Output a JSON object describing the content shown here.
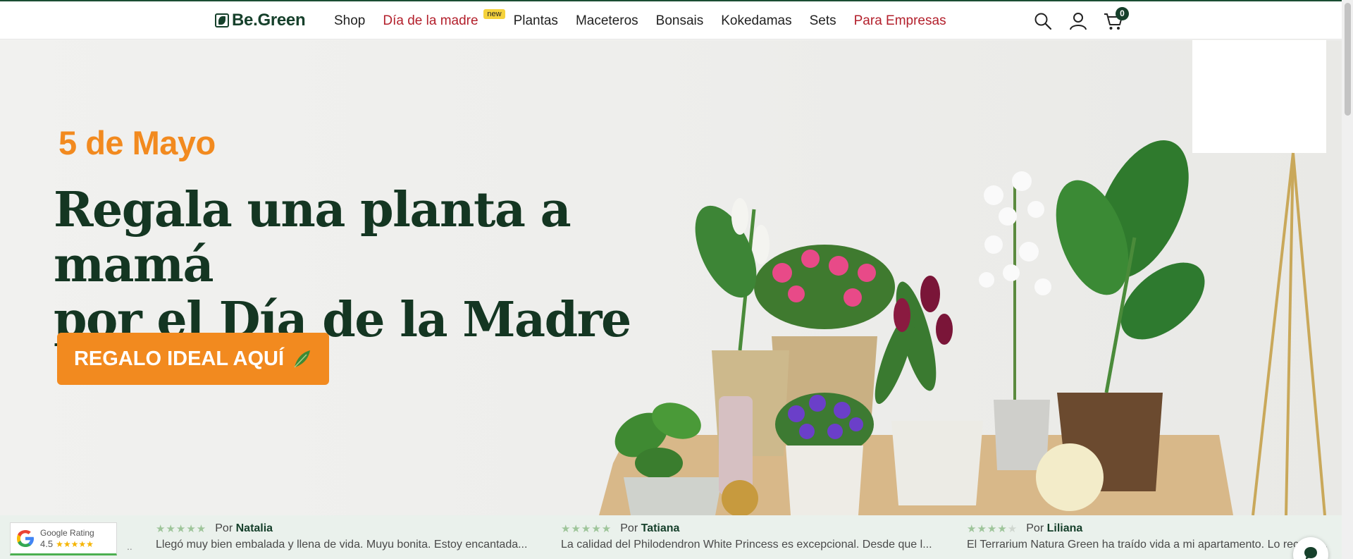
{
  "header": {
    "logo_text": "Be.Green",
    "nav": [
      {
        "label": "Shop",
        "highlight": false
      },
      {
        "label": "Día de la madre",
        "highlight": true,
        "badge": "new"
      },
      {
        "label": "Plantas",
        "highlight": false
      },
      {
        "label": "Maceteros",
        "highlight": false
      },
      {
        "label": "Bonsais",
        "highlight": false
      },
      {
        "label": "Kokedamas",
        "highlight": false
      },
      {
        "label": "Sets",
        "highlight": false
      },
      {
        "label": "Para Empresas",
        "highlight": true
      }
    ],
    "icons": [
      "search-icon",
      "user-icon",
      "cart-icon"
    ],
    "cart_count": "0"
  },
  "hero": {
    "date": "5 de Mayo",
    "title_line1": "Regala una planta a mamá",
    "title_line2": "por el Día de la Madre",
    "cta_label": "REGALO IDEAL AQUÍ",
    "cta_icon": "leaf-icon"
  },
  "reviews": {
    "google": {
      "label": "Google Rating",
      "score": "4.5",
      "stars": "★★★★★"
    },
    "items": [
      {
        "stars": 5,
        "by": "Por",
        "author": "Natalia",
        "text": "Llegó muy bien embalada y llena de vida. Muyu bonita. Estoy encantada..."
      },
      {
        "stars": 5,
        "by": "Por",
        "author": "Tatiana",
        "text": "La calidad del Philodendron White Princess es excepcional. Desde que l..."
      },
      {
        "stars": 4,
        "by": "Por",
        "author": "Liliana",
        "text": "El Terrarium Natura Green ha traído vida a mi apartamento. Lo recomien..."
      }
    ],
    "ellipsis": ".."
  },
  "colors": {
    "brand_green": "#16402b",
    "accent_orange": "#f28a1f",
    "highlight_red": "#b3202c"
  }
}
